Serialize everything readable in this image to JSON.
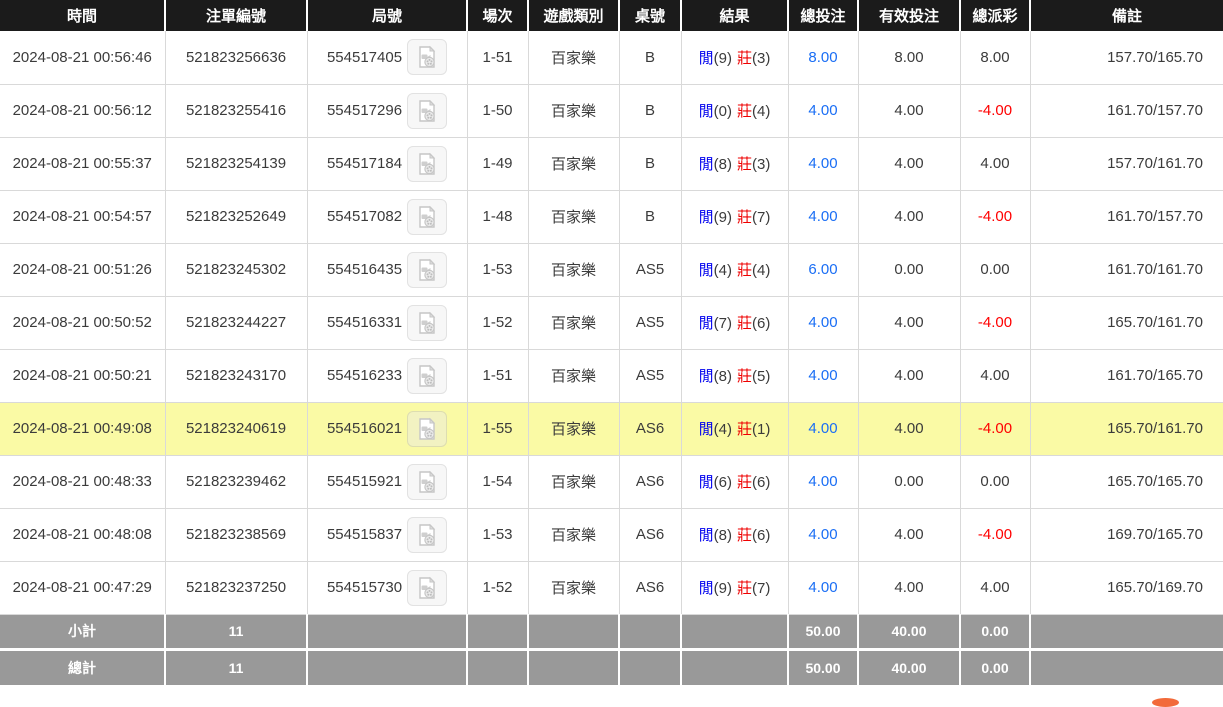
{
  "table": {
    "columns": [
      {
        "key": "time",
        "label": "時間"
      },
      {
        "key": "bet_id",
        "label": "注單編號"
      },
      {
        "key": "round",
        "label": "局號"
      },
      {
        "key": "session",
        "label": "場次"
      },
      {
        "key": "game",
        "label": "遊戲類別"
      },
      {
        "key": "table_no",
        "label": "桌號"
      },
      {
        "key": "result",
        "label": "結果"
      },
      {
        "key": "total_bet",
        "label": "總投注"
      },
      {
        "key": "valid_bet",
        "label": "有效投注"
      },
      {
        "key": "payout",
        "label": "總派彩"
      },
      {
        "key": "remark",
        "label": "備註"
      }
    ],
    "result_labels": {
      "player": "閒",
      "banker": "莊"
    },
    "icons": {
      "round_video": "video-record-icon"
    },
    "rows": [
      {
        "time": "2024-08-21 00:56:46",
        "bet_id": "521823256636",
        "round": "554517405",
        "session": "1-51",
        "game": "百家樂",
        "table_no": "B",
        "player": "(9)",
        "banker": "(3)",
        "total_bet": "8.00",
        "valid_bet": "8.00",
        "payout": "8.00",
        "remark": "157.70/165.70",
        "highlight": false
      },
      {
        "time": "2024-08-21 00:56:12",
        "bet_id": "521823255416",
        "round": "554517296",
        "session": "1-50",
        "game": "百家樂",
        "table_no": "B",
        "player": "(0)",
        "banker": "(4)",
        "total_bet": "4.00",
        "valid_bet": "4.00",
        "payout": "-4.00",
        "remark": "161.70/157.70",
        "highlight": false
      },
      {
        "time": "2024-08-21 00:55:37",
        "bet_id": "521823254139",
        "round": "554517184",
        "session": "1-49",
        "game": "百家樂",
        "table_no": "B",
        "player": "(8)",
        "banker": "(3)",
        "total_bet": "4.00",
        "valid_bet": "4.00",
        "payout": "4.00",
        "remark": "157.70/161.70",
        "highlight": false
      },
      {
        "time": "2024-08-21 00:54:57",
        "bet_id": "521823252649",
        "round": "554517082",
        "session": "1-48",
        "game": "百家樂",
        "table_no": "B",
        "player": "(9)",
        "banker": "(7)",
        "total_bet": "4.00",
        "valid_bet": "4.00",
        "payout": "-4.00",
        "remark": "161.70/157.70",
        "highlight": false
      },
      {
        "time": "2024-08-21 00:51:26",
        "bet_id": "521823245302",
        "round": "554516435",
        "session": "1-53",
        "game": "百家樂",
        "table_no": "AS5",
        "player": "(4)",
        "banker": "(4)",
        "total_bet": "6.00",
        "valid_bet": "0.00",
        "payout": "0.00",
        "remark": "161.70/161.70",
        "highlight": false
      },
      {
        "time": "2024-08-21 00:50:52",
        "bet_id": "521823244227",
        "round": "554516331",
        "session": "1-52",
        "game": "百家樂",
        "table_no": "AS5",
        "player": "(7)",
        "banker": "(6)",
        "total_bet": "4.00",
        "valid_bet": "4.00",
        "payout": "-4.00",
        "remark": "165.70/161.70",
        "highlight": false
      },
      {
        "time": "2024-08-21 00:50:21",
        "bet_id": "521823243170",
        "round": "554516233",
        "session": "1-51",
        "game": "百家樂",
        "table_no": "AS5",
        "player": "(8)",
        "banker": "(5)",
        "total_bet": "4.00",
        "valid_bet": "4.00",
        "payout": "4.00",
        "remark": "161.70/165.70",
        "highlight": false
      },
      {
        "time": "2024-08-21 00:49:08",
        "bet_id": "521823240619",
        "round": "554516021",
        "session": "1-55",
        "game": "百家樂",
        "table_no": "AS6",
        "player": "(4)",
        "banker": "(1)",
        "total_bet": "4.00",
        "valid_bet": "4.00",
        "payout": "-4.00",
        "remark": "165.70/161.70",
        "highlight": true
      },
      {
        "time": "2024-08-21 00:48:33",
        "bet_id": "521823239462",
        "round": "554515921",
        "session": "1-54",
        "game": "百家樂",
        "table_no": "AS6",
        "player": "(6)",
        "banker": "(6)",
        "total_bet": "4.00",
        "valid_bet": "0.00",
        "payout": "0.00",
        "remark": "165.70/165.70",
        "highlight": false
      },
      {
        "time": "2024-08-21 00:48:08",
        "bet_id": "521823238569",
        "round": "554515837",
        "session": "1-53",
        "game": "百家樂",
        "table_no": "AS6",
        "player": "(8)",
        "banker": "(6)",
        "total_bet": "4.00",
        "valid_bet": "4.00",
        "payout": "-4.00",
        "remark": "169.70/165.70",
        "highlight": false
      },
      {
        "time": "2024-08-21 00:47:29",
        "bet_id": "521823237250",
        "round": "554515730",
        "session": "1-52",
        "game": "百家樂",
        "table_no": "AS6",
        "player": "(9)",
        "banker": "(7)",
        "total_bet": "4.00",
        "valid_bet": "4.00",
        "payout": "4.00",
        "remark": "165.70/169.70",
        "highlight": false
      }
    ],
    "footer": [
      {
        "label": "小計",
        "count": "11",
        "total_bet": "50.00",
        "valid_bet": "40.00",
        "payout": "0.00"
      },
      {
        "label": "總計",
        "count": "11",
        "total_bet": "50.00",
        "valid_bet": "40.00",
        "payout": "0.00"
      }
    ]
  },
  "colors": {
    "header_bg": "#1b1b1b",
    "highlight_row": "#fafaa5",
    "footer_bg": "#999999",
    "bet_amount_blue": "#1a6ef5",
    "player_blue": "#0000ee",
    "banker_red": "#ee0000",
    "negative_red": "#ff0000",
    "row_border": "#d9d9d9",
    "bottom_peek_orange": "#f26a3a"
  }
}
